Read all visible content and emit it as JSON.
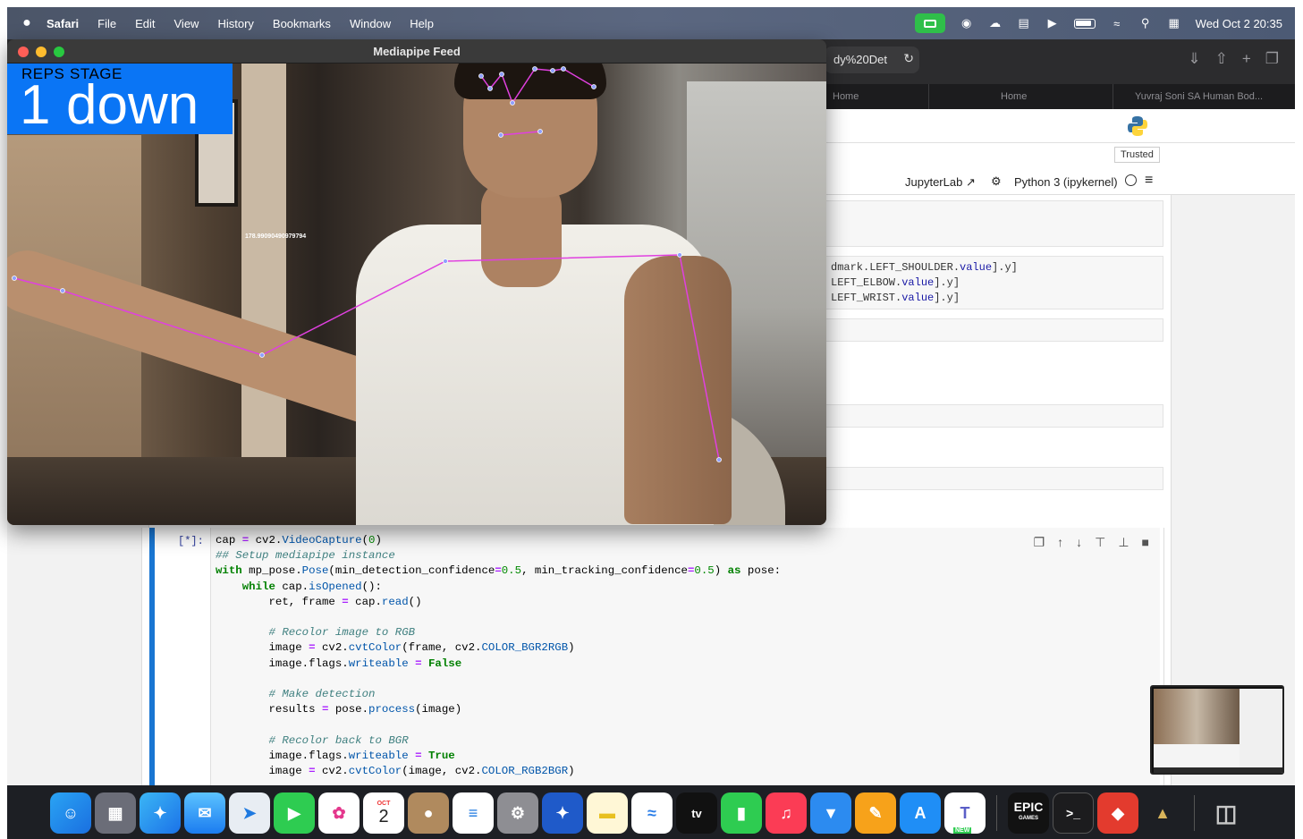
{
  "menubar": {
    "apple": "",
    "items": [
      "Safari",
      "File",
      "Edit",
      "View",
      "History",
      "Bookmarks",
      "Window",
      "Help"
    ],
    "datetime": "Wed Oct 2  20:35"
  },
  "safari": {
    "url_fragment": "dy%20Det",
    "tabs": [
      "Home",
      "Home",
      "Yuvraj Soni SA Human Bod..."
    ]
  },
  "jupyter": {
    "trusted": "Trusted",
    "jupyterlab": "JupyterLab",
    "kernel": "Python 3 (ipykernel)"
  },
  "code_fragments": [
    {
      "pre": "dmark.LEFT_SHOULDER.",
      "attr": "value",
      "post": "].y]"
    },
    {
      "pre": "LEFT_ELBOW.",
      "attr": "value",
      "post": "].y]"
    },
    {
      "pre": "LEFT_WRIST.",
      "attr": "value",
      "post": "].y]"
    }
  ],
  "cell": {
    "prompt": "[*]:"
  },
  "mediapipe": {
    "window_title": "Mediapipe Feed",
    "reps_label": "REPS",
    "stage_label": "STAGE",
    "reps_value": "1",
    "stage_value": "down",
    "angle": "178.99090490979794",
    "landmark_color": "#e040e0",
    "box_color": "#0a75f5"
  },
  "dock": {
    "calendar_month": "OCT",
    "calendar_day": "2",
    "tv": "tv",
    "epic": "EPIC",
    "epic_sub": "GAMES",
    "teams_badge": "NEW"
  }
}
